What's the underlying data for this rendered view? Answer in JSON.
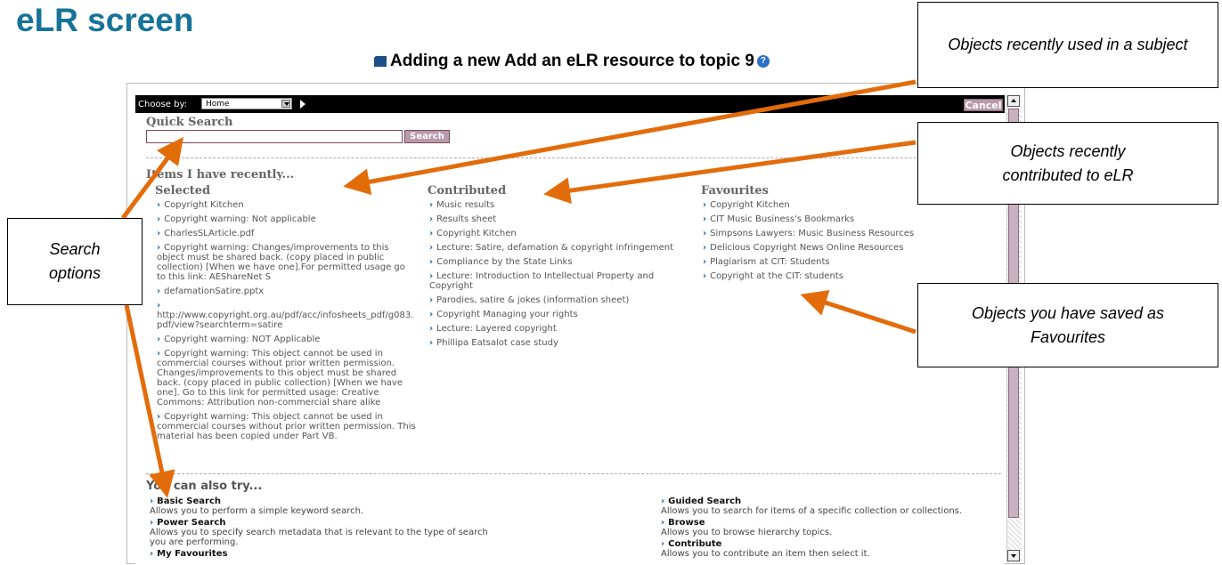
{
  "slide_title": "eLR screen",
  "page_heading": "Adding a new Add an eLR resource to topic 9",
  "topbar": {
    "choose_label": "Choose by:",
    "choose_value": "Home",
    "cancel_label": "Cancel"
  },
  "quick_search": {
    "title": "Quick Search",
    "placeholder": "",
    "button_label": "Search"
  },
  "recent": {
    "title": "Items I have recently...",
    "selected": {
      "heading": "Selected",
      "items": [
        "Copyright Kitchen",
        "Copyright warning: Not applicable",
        "CharlesSLArticle.pdf",
        "Copyright warning: Changes/improvements to this object must be shared back. (copy placed in public collection) [When we have one].For permitted usage go to this link: AEShareNet S",
        "defamationSatire.pptx",
        "http://www.copyright.org.au/pdf/acc/infosheets_pdf/g083.pdf/view?searchterm=satire",
        "Copyright warning: NOT Applicable",
        "Copyright warning: This object cannot be used in commercial courses without prior written permission. Changes/improvements to this object must be shared back. (copy placed in public collection) [When we have one]. Go to this link for permitted usage: Creative Commons: Attribution non-commercial share alike",
        "Copyright warning: This object cannot be used in commercial courses without prior written permission. This material has been copied under Part VB."
      ]
    },
    "contributed": {
      "heading": "Contributed",
      "items": [
        "Music results",
        "Results sheet",
        "Copyright Kitchen",
        "Lecture: Satire, defamation & copyright infringement",
        "Compliance by the State Links",
        "Lecture: Introduction to Intellectual Property and Copyright",
        "Parodies, satire & jokes (information sheet)",
        "Copyright Managing your rights",
        "Lecture: Layered copyright",
        "Phillipa Eatsalot case study"
      ]
    },
    "favourites": {
      "heading": "Favourites",
      "items": [
        "Copyright Kitchen",
        "CIT Music Business's Bookmarks",
        "Simpsons Lawyers: Music Business Resources",
        "Delicious Copyright News Online Resources",
        "Plagiarism at CIT: Students",
        "Copyright at the CIT: students"
      ]
    }
  },
  "try": {
    "title": "You can also try...",
    "left": [
      {
        "label": "Basic Search",
        "desc": "Allows you to perform a simple keyword search."
      },
      {
        "label": "Power Search",
        "desc": "Allows you to specify search metadata that is relevant to the type of search you are performing."
      },
      {
        "label": "My Favourites",
        "desc": ""
      }
    ],
    "right": [
      {
        "label": "Guided Search",
        "desc": "Allows you to search for items of a specific collection or collections."
      },
      {
        "label": "Browse",
        "desc": "Allows you to browse hierarchy topics."
      },
      {
        "label": "Contribute",
        "desc": "Allows you to contribute an item then select it."
      }
    ]
  },
  "callouts": {
    "recently_used": "Objects recently used in a subject",
    "recently_contributed": "Objects recently contributed to eLR",
    "search_options": "Search options",
    "favourites": "Objects you have saved as Favourites"
  },
  "colors": {
    "title": "#16739a",
    "arrow": "#e36c0a",
    "link_arrow": "#1a5ca8",
    "button": "#b89aab"
  }
}
